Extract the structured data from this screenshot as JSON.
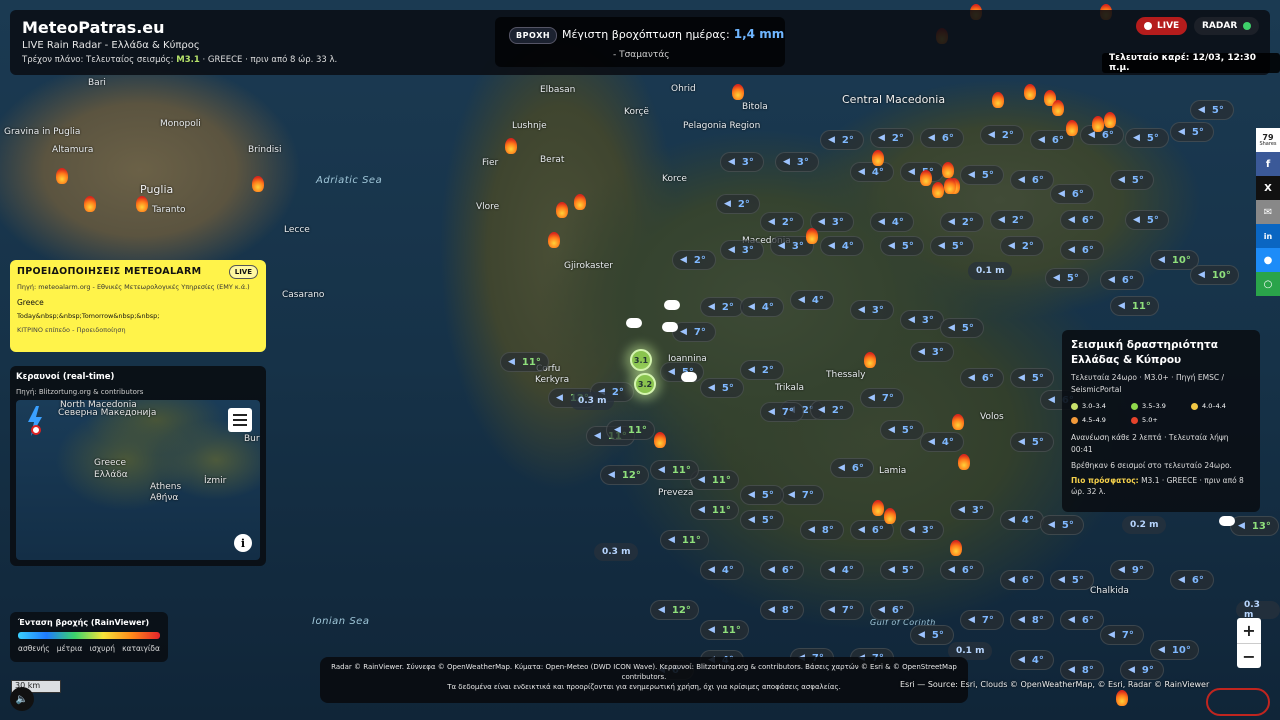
{
  "header": {
    "title": "MeteoPatras.eu",
    "subtitle": "LIVE Rain Radar - Ελλάδα & Κύπρος",
    "quake_prefix": "Τρέχον πλάνο: Τελευταίος σεισμός:",
    "quake_mag": "M3.1",
    "quake_rest": "· GREECE · πριν από 8 ώρ. 33 λ."
  },
  "rain_box": {
    "tag": "ΒΡΟΧΗ",
    "label": "Μέγιστη βροχόπτωση ημέρας:",
    "value": "1,4 mm",
    "place": "- Τσαμαντάς"
  },
  "status": {
    "live_label": "LIVE",
    "radar_label": "RADAR",
    "frame_time": "Τελευταίο καρέ: 12/03, 12:30 π.μ."
  },
  "meteoalarm": {
    "title": "ΠΡΟΕΙΔΟΠΟΙΗΣΕΙΣ METEOALARM",
    "live": "LIVE",
    "source": "Πηγή: meteoalarm.org - Εθνικές Μετεωρολογικές Υπηρεσίες (ΕΜΥ κ.ά.)",
    "country": "Greece",
    "days": "Today&nbsp;&nbsp;Tomorrow&nbsp;&nbsp;",
    "level": "ΚΙΤΡΙΝΟ επίπεδο - Προειδοποίηση"
  },
  "lightning": {
    "title": "Κεραυνοί (real-time)",
    "source": "Πηγή: Blitzortung.org & contributors",
    "labels": [
      "North Macedonia",
      "Северна Македонија",
      "Greece",
      "Ελλάδα",
      "Athens",
      "Αθήνα",
      "İzmir",
      "Bur"
    ]
  },
  "legend": {
    "title": "Ένταση βροχής (RainViewer)",
    "labels": [
      "ασθενής",
      "μέτρια",
      "ισχυρή",
      "καταιγίδα"
    ]
  },
  "scale": {
    "label": "30 km"
  },
  "seismic": {
    "title": "Σεισμική δραστηριότητα Ελλάδας & Κύπρου",
    "desc": "Τελευταία 24ωρο · M3.0+ · Πηγή EMSC / SeismicPortal",
    "ranges": [
      {
        "label": "3.0–3.4",
        "color": "#c8e06b"
      },
      {
        "label": "3.5–3.9",
        "color": "#8fd84b"
      },
      {
        "label": "4.0–4.4",
        "color": "#f2c744"
      },
      {
        "label": "4.5–4.9",
        "color": "#f29a3a"
      },
      {
        "label": "5.0+",
        "color": "#e5432b"
      }
    ],
    "refresh": "Ανανέωση κάθε 2 λεπτά · Τελευταία λήψη 00:41",
    "count": "Βρέθηκαν 6 σεισμοί στο τελευταίο 24ωρο.",
    "recent_label": "Πιο πρόσφατος:",
    "recent": "M3.1 · GREECE · πριν από 8 ώρ. 32 λ."
  },
  "share": {
    "count": "79",
    "unit": "Shares"
  },
  "credits": {
    "line1": "Radar © RainViewer. Σύννεφα © OpenWeatherMap. Κύματα: Open-Meteo (DWD ICON Wave). Κεραυνοί: Blitzortung.org & contributors. Βάσεις χαρτών © Esri & © OpenStreetMap contributors.",
    "line2": "Τα δεδομένα είναι ενδεικτικά και προορίζονται για ενημερωτική χρήση, όχι για κρίσιμες αποφάσεις ασφαλείας.",
    "esri": "Esri — Source: Esri, Clouds © OpenWeatherMap, © Esri, Radar © RainViewer"
  },
  "map": {
    "seas": [
      "Adriatic Sea",
      "Ionian Sea",
      "Gulf of Corinth"
    ],
    "places": [
      "Bari",
      "Monopoli",
      "Altamura",
      "Gravina in Puglia",
      "Puglia",
      "Taranto",
      "Brindisi",
      "Lecce",
      "Casarano",
      "Elbasan",
      "Lushnje",
      "Berat",
      "Fier",
      "Vlore",
      "Korce",
      "Gjirokaster",
      "Ohrid",
      "Bitola",
      "Pelagonia Region",
      "Central Macedonia",
      "Macedonia",
      "Thessaly",
      "Trikala",
      "Volos",
      "Ioannina",
      "Preveza",
      "Lamia",
      "Chalkida",
      "Corfu",
      "Kerkyra",
      "Korçë"
    ],
    "quakes": [
      "3.1",
      "3.2"
    ],
    "waves": [
      "0.1 m",
      "0.2 m",
      "0.3 m",
      "0.3 m",
      "0.3 m",
      "0.1 m"
    ]
  }
}
